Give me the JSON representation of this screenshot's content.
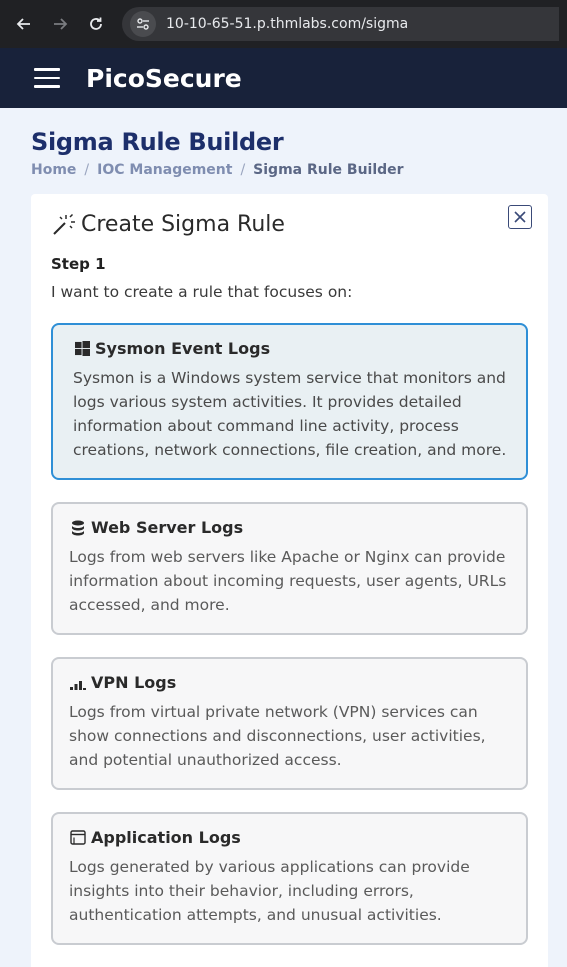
{
  "browser": {
    "url": "10-10-65-51.p.thmlabs.com/sigma"
  },
  "header": {
    "brand": "PicoSecure"
  },
  "page": {
    "title": "Sigma Rule Builder",
    "breadcrumb": [
      "Home",
      "IOC Management",
      "Sigma Rule Builder"
    ]
  },
  "card": {
    "title": "Create Sigma Rule",
    "step_label": "Step 1",
    "step_desc": "I want to create a rule that focuses on:",
    "options": [
      {
        "title": "Sysmon Event Logs",
        "icon": "windows-icon",
        "desc": "Sysmon is a Windows system service that monitors and logs various system activities. It provides detailed information about command line activity, process creations, network connections, file creation, and more.",
        "selected": true
      },
      {
        "title": "Web Server Logs",
        "icon": "database-icon",
        "desc": "Logs from web servers like Apache or Nginx can provide information about incoming requests, user agents, URLs accessed, and more.",
        "selected": false
      },
      {
        "title": "VPN Logs",
        "icon": "signal-icon",
        "desc": "Logs from virtual private network (VPN) services can show connections and disconnections, user activities, and potential unauthorized access.",
        "selected": false
      },
      {
        "title": "Application Logs",
        "icon": "window-icon",
        "desc": "Logs generated by various applications can provide insights into their behavior, including errors, authentication attempts, and unusual activities.",
        "selected": false
      }
    ]
  },
  "colors": {
    "header_bg": "#18223a",
    "title": "#1d2f6b",
    "selected_border": "#2f8fd6"
  }
}
